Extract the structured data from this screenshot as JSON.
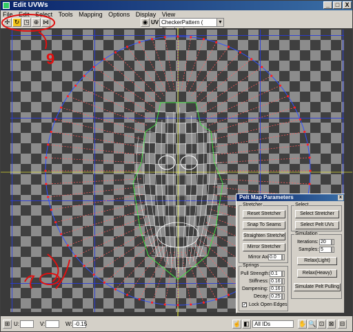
{
  "window": {
    "title": "Edit UVWs"
  },
  "title_buttons": [
    "_",
    "□",
    "X"
  ],
  "menu": [
    "File",
    "Edit",
    "Select",
    "Tools",
    "Mapping",
    "Options",
    "Display",
    "View"
  ],
  "toolbar": {
    "uv_label": "UV",
    "texture": "CheckerPattern  ( Checker )"
  },
  "annotations": {
    "nine": "9",
    "ten": "10"
  },
  "panel": {
    "title": "Pelt Map Parameters",
    "close": "x",
    "stretcher": {
      "label": "Stretcher",
      "reset": "Reset Stretcher",
      "snap": "Snap To Seams",
      "straighten": "Straighten Stretcher",
      "mirror": "Mirror Stretcher",
      "mirror_axis_label": "Mirror Axis:",
      "mirror_axis_value": "0.0"
    },
    "select": {
      "label": "Select",
      "select_stretcher": "Select Stretcher",
      "select_pelt": "Select Pelt UVs"
    },
    "simulation": {
      "label": "Simulation",
      "iterations_label": "Iterations:",
      "iterations_value": "20",
      "samples_label": "Samples:",
      "samples_value": "5",
      "relax_light": "Relax(Light)",
      "relax_heavy": "Relax(Heavy)",
      "simulate": "Simulate Pelt Pulling"
    },
    "springs": {
      "label": "Springs",
      "pull_label": "Pull Strength:",
      "pull_value": "0.1",
      "stiffness_label": "Stiffness:",
      "stiffness_value": "0.16",
      "dampening_label": "Dampening:",
      "dampening_value": "0.16",
      "decay_label": "Decay:",
      "decay_value": "0.25",
      "lock_label": "Lock Open Edges",
      "lock_checked": true
    }
  },
  "statusbar": {
    "u_label": "U:",
    "u_value": "",
    "v_label": "V:",
    "v_value": "",
    "w_label": "W:",
    "w_value": "-0.15",
    "ids": "All IDs"
  }
}
